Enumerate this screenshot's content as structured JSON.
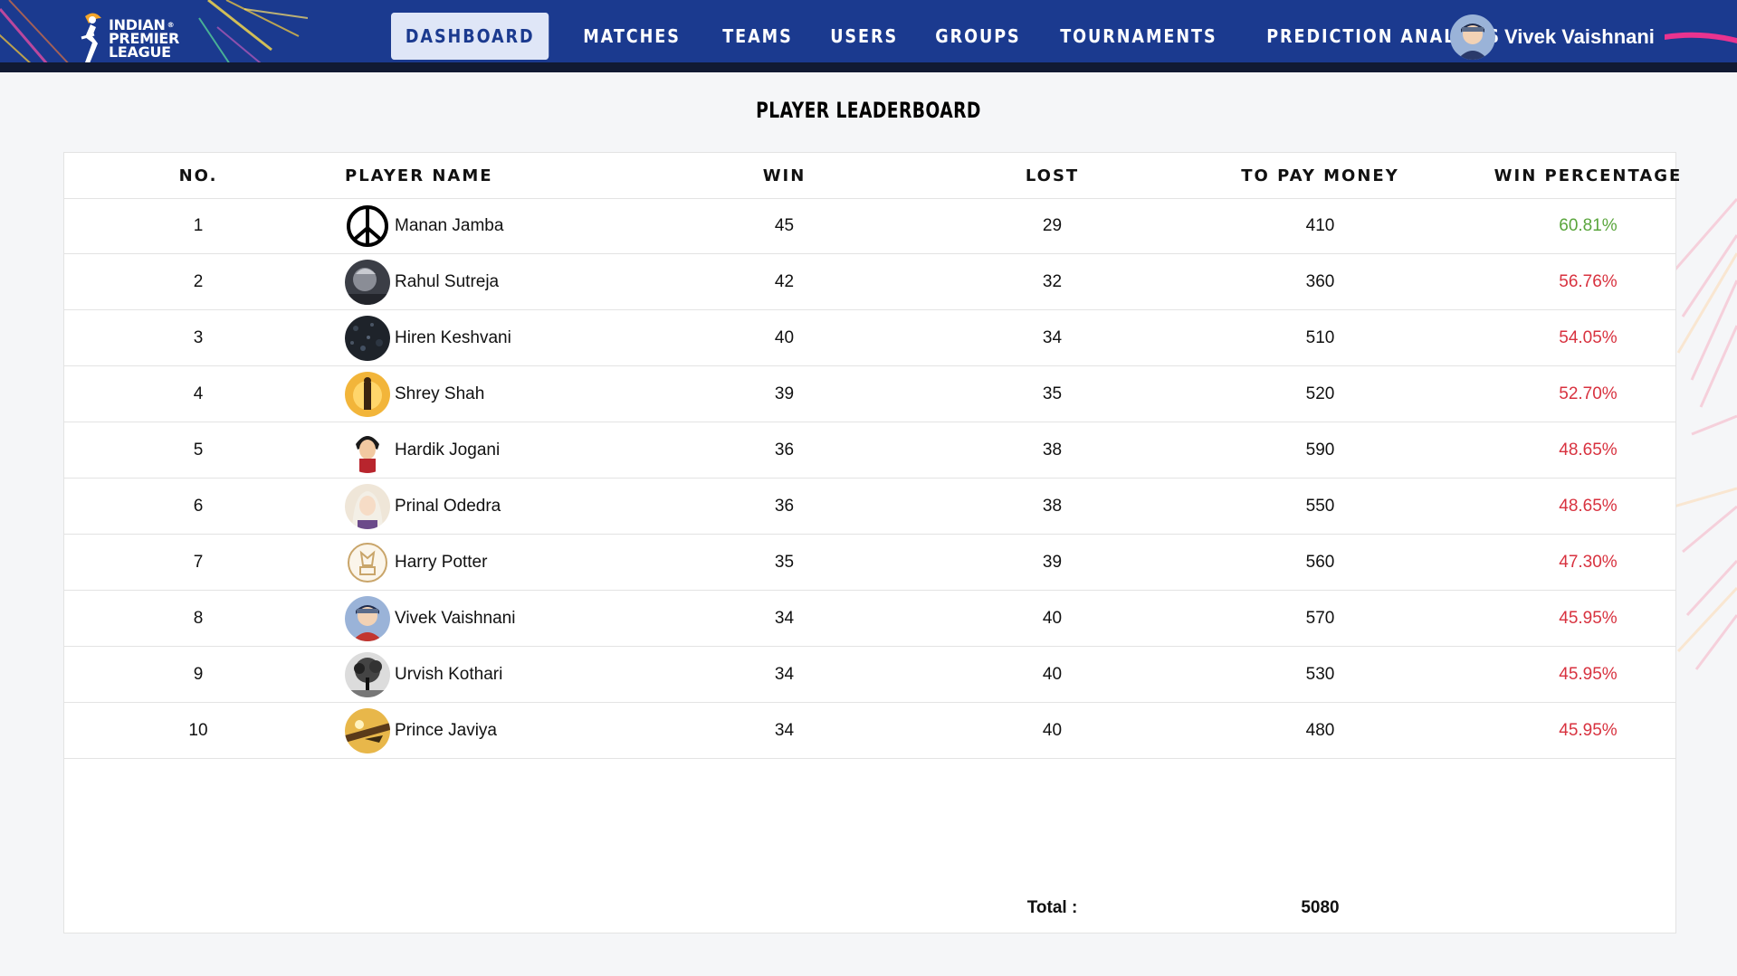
{
  "brand": {
    "line1": "INDIAN",
    "line2": "PREMIER",
    "line3": "LEAGUE",
    "reg": "®"
  },
  "nav": {
    "items": [
      {
        "label": "DASHBOARD",
        "active": true
      },
      {
        "label": "MATCHES",
        "active": false
      },
      {
        "label": "TEAMS",
        "active": false
      },
      {
        "label": "USERS",
        "active": false
      },
      {
        "label": "GROUPS",
        "active": false
      },
      {
        "label": "TOURNAMENTS",
        "active": false
      },
      {
        "label": "PREDICTION ANALYSIS",
        "active": false
      }
    ]
  },
  "user": {
    "name": "Vivek Vaishnani"
  },
  "page": {
    "title": "PLAYER LEADERBOARD"
  },
  "table": {
    "headers": [
      "NO.",
      "PLAYER NAME",
      "WIN",
      "LOST",
      "TO PAY MONEY",
      "WIN PERCENTAGE"
    ],
    "rows": [
      {
        "no": "1",
        "name": "Manan Jamba",
        "avatar": "peace-sign-icon",
        "win": "45",
        "lost": "29",
        "pay": "410",
        "pct": "60.81%",
        "status": "good"
      },
      {
        "no": "2",
        "name": "Rahul Sutreja",
        "avatar": "dark-portrait",
        "win": "42",
        "lost": "32",
        "pay": "360",
        "pct": "56.76%",
        "status": "bad"
      },
      {
        "no": "3",
        "name": "Hiren Keshvani",
        "avatar": "dark-texture",
        "win": "40",
        "lost": "34",
        "pay": "510",
        "pct": "54.05%",
        "status": "bad"
      },
      {
        "no": "4",
        "name": "Shrey Shah",
        "avatar": "sunset-figure",
        "win": "39",
        "lost": "35",
        "pay": "520",
        "pct": "52.70%",
        "status": "bad"
      },
      {
        "no": "5",
        "name": "Hardik Jogani",
        "avatar": "cartoon-boy",
        "win": "36",
        "lost": "38",
        "pay": "590",
        "pct": "48.65%",
        "status": "bad"
      },
      {
        "no": "6",
        "name": "Prinal Odedra",
        "avatar": "anime-girl",
        "win": "36",
        "lost": "38",
        "pay": "550",
        "pct": "48.65%",
        "status": "bad"
      },
      {
        "no": "7",
        "name": "Harry Potter",
        "avatar": "crest-logo",
        "win": "35",
        "lost": "39",
        "pay": "560",
        "pct": "47.30%",
        "status": "bad"
      },
      {
        "no": "8",
        "name": "Vivek Vaishnani",
        "avatar": "anime-ninja",
        "win": "34",
        "lost": "40",
        "pay": "570",
        "pct": "45.95%",
        "status": "bad"
      },
      {
        "no": "9",
        "name": "Urvish Kothari",
        "avatar": "bw-tree",
        "win": "34",
        "lost": "40",
        "pay": "530",
        "pct": "45.95%",
        "status": "bad"
      },
      {
        "no": "10",
        "name": "Prince Javiya",
        "avatar": "golden-scene",
        "win": "34",
        "lost": "40",
        "pay": "480",
        "pct": "45.95%",
        "status": "bad"
      }
    ],
    "total_label": "Total :",
    "total_value": "5080"
  },
  "colors": {
    "nav_bg": "#1b3a8f",
    "nav_active_bg": "#dfe6f7",
    "good": "#5aa53c",
    "bad": "#d8323f"
  }
}
